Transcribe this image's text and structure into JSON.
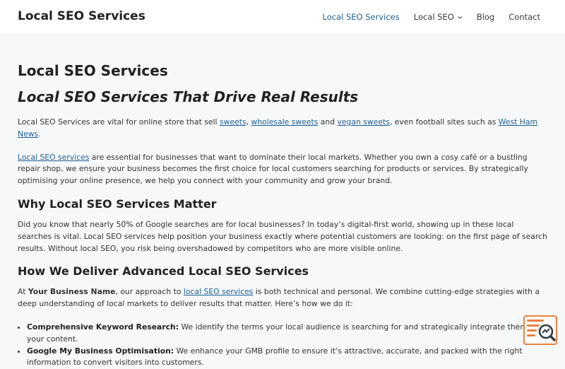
{
  "header": {
    "site_title": "Local SEO Services",
    "nav": [
      {
        "label": "Local SEO Services",
        "current": true
      },
      {
        "label": "Local SEO",
        "has_dropdown": true
      },
      {
        "label": "Blog"
      },
      {
        "label": "Contact"
      }
    ]
  },
  "content": {
    "page_title": "Local SEO Services",
    "hero_heading": "Local SEO Services That Drive Real Results",
    "intro": {
      "t1": "Local SEO Services are vital for online store that sell ",
      "l1": "sweets",
      "t2": ", ",
      "l2": "wholesale sweets",
      "t3": " and ",
      "l3": "vegan sweets",
      "t4": ", even football sites such as ",
      "l4": "West Ham News",
      "t5": "."
    },
    "para2": {
      "link": "Local SEO services",
      "text": " are essential for businesses that want to dominate their local markets. Whether you own a cosy café or a bustling repair shop, we ensure your business becomes the first choice for local customers searching for products or services. By strategically optimising your online presence, we help you connect with your community and grow your brand."
    },
    "h_why": "Why Local SEO Services Matter",
    "para_why": "Did you know that nearly 50% of Google searches are for local businesses? In today’s digital-first world, showing up in these local searches is vital. Local SEO services help position your business exactly where potential customers are looking: on the first page of search results. Without local SEO, you risk being overshadowed by competitors who are more visible online.",
    "h_how": "How We Deliver Advanced Local SEO Services",
    "para_how": {
      "t1": "At ",
      "bold": "Your Business Name",
      "t2": ", our approach to ",
      "link": "local SEO services",
      "t3": " is both technical and personal. We combine cutting-edge strategies with a deep understanding of local markets to deliver results that matter. Here’s how we do it:"
    },
    "bullets": [
      {
        "bold": "Comprehensive Keyword Research:",
        "text": " We identify the terms your local audience is searching for and strategically integrate them into your content."
      },
      {
        "bold": "Google My Business Optimisation:",
        "text": " We enhance your GMB profile to ensure it’s attractive, accurate, and packed with the right information to convert visitors into customers."
      }
    ]
  },
  "colors": {
    "link": "#1e5f95",
    "badge": "#e9823f"
  },
  "icons": {
    "badge": "search-document-icon",
    "nav_dropdown": "chevron-down-icon"
  }
}
